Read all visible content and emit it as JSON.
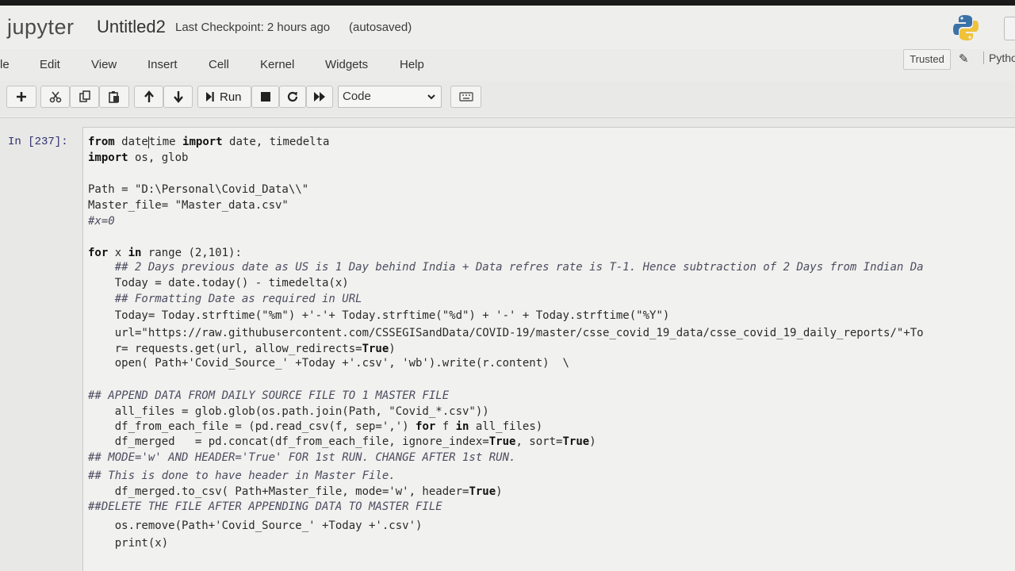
{
  "header": {
    "logo_text": "jupyter",
    "notebook_title": "Untitled2",
    "checkpoint": "Last Checkpoint: 2 hours ago",
    "autosave": "(autosaved)"
  },
  "menu": {
    "items": [
      "le",
      "Edit",
      "View",
      "Insert",
      "Cell",
      "Kernel",
      "Widgets",
      "Help"
    ],
    "trusted": "Trusted",
    "kernel": "Pytho"
  },
  "toolbar": {
    "run_label": "Run",
    "cell_type": "Code"
  },
  "cell": {
    "prompt": "In [237]:",
    "lines": [
      "from datetime import date, timedelta",
      "import os, glob",
      "",
      "Path = \"D:\\Personal\\Covid_Data\\\\\"",
      "Master_file= \"Master_data.csv\"",
      "#x=0",
      "",
      "for x in range (2,101):",
      "    ## 2 Days previous date as US is 1 Day behind India + Data refres rate is T-1. Hence subtraction of 2 Days from Indian Da",
      "    Today = date.today() - timedelta(x)",
      "    ## Formatting Date as required in URL",
      "    Today= Today.strftime(\"%m\") +'-'+ Today.strftime(\"%d\") + '-' + Today.strftime(\"%Y\")",
      "    url=\"https://raw.githubusercontent.com/CSSEGISandData/COVID-19/master/csse_covid_19_data/csse_covid_19_daily_reports/\"+To",
      "    r= requests.get(url, allow_redirects=True)",
      "    open( Path+'Covid_Source_' +Today +'.csv', 'wb').write(r.content)  \\",
      "",
      "## APPEND DATA FROM DAILY SOURCE FILE TO 1 MASTER FILE",
      "    all_files = glob.glob(os.path.join(Path, \"Covid_*.csv\"))",
      "    df_from_each_file = (pd.read_csv(f, sep=',') for f in all_files)",
      "    df_merged   = pd.concat(df_from_each_file, ignore_index=True, sort=True)",
      "## MODE='w' AND HEADER='True' FOR 1st RUN. CHANGE AFTER 1st RUN.",
      "## This is done to have header in Master File.",
      "    df_merged.to_csv( Path+Master_file, mode='w', header=True)",
      "##DELETE THE FILE AFTER APPENDING DATA TO MASTER FILE",
      "    os.remove(Path+'Covid_Source_' +Today +'.csv')",
      "    print(x)"
    ]
  }
}
